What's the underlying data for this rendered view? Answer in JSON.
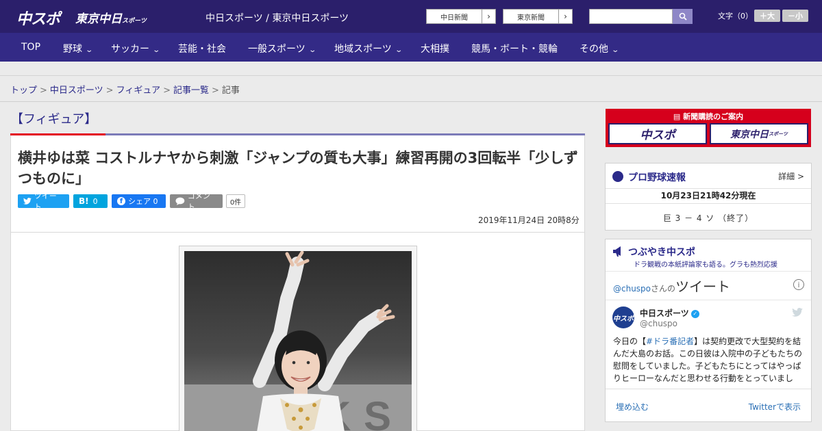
{
  "header": {
    "logo_chuspo": "中スポ",
    "logo_tokyo": "東京中日",
    "logo_tokyo_small": "スポーツ",
    "site_title": "中日スポーツ / 東京中日スポーツ",
    "ext_links": [
      "中日新聞",
      "東京新聞"
    ],
    "search_placeholder": "",
    "font_size_label": "文字（0）",
    "font_larger": "＋大",
    "font_smaller": "－小"
  },
  "nav": {
    "items": [
      {
        "label": "TOP"
      },
      {
        "label": "野球"
      },
      {
        "label": "サッカー"
      },
      {
        "label": "芸能・社会"
      },
      {
        "label": "一般スポーツ"
      },
      {
        "label": "地域スポーツ"
      },
      {
        "label": "大相撲"
      },
      {
        "label": "競馬・ボート・競輪"
      },
      {
        "label": "その他"
      }
    ]
  },
  "breadcrumb": {
    "items": [
      "トップ",
      "中日スポーツ",
      "フィギュア",
      "記事一覧"
    ],
    "current": "記事",
    "separator": ">"
  },
  "article": {
    "category": "【フィギュア】",
    "headline": "横井ゆは菜 コストルナヤから刺激「ジャンプの質も大事」練習再開の3回転半「少しずつものに」",
    "share": {
      "tweet": "ツイート",
      "hatena_count": "0",
      "facebook": "シェア 0",
      "comment": "コメント",
      "comment_count": "0件"
    },
    "date": "2019年11月24日 20時8分"
  },
  "sidebar": {
    "ad": {
      "title": "新聞購読のご案内",
      "left": "中スポ",
      "right": "東京中日",
      "right_small": "スポーツ"
    },
    "baseball": {
      "title": "プロ野球速報",
      "detail": "詳細 >",
      "time": "10月23日21時42分現在",
      "score": "巨 3 － 4 ソ （終了）"
    },
    "twitter": {
      "title": "つぶやき中スポ",
      "subtitle": "ドラ観戦の本紙評論家も語る。グラも熱烈応援",
      "handle": "@chuspo",
      "handle_suffix": "さんの",
      "handle_big": "ツイート",
      "avatar_text": "中スポ",
      "name": "中日スポーツ",
      "user": "@chuspo",
      "text_pre": "今日の【",
      "text_tag": "#ドラ番記者",
      "text_post": "】は契約更改で大型契約を結んだ大島のお話。この日彼は入院中の子どもたちの慰問をしていました。子どもたちにとってはやっぱりヒーローなんだと思わせる行動をとっていまし",
      "embed": "埋め込む",
      "view": "Twitterで表示"
    }
  },
  "colors": {
    "header_bg": "#2b1f6b",
    "nav_bg": "#332a86",
    "accent_red": "#e3001b",
    "link_blue": "#2b2a8a",
    "twitter_blue": "#1da1f2"
  }
}
